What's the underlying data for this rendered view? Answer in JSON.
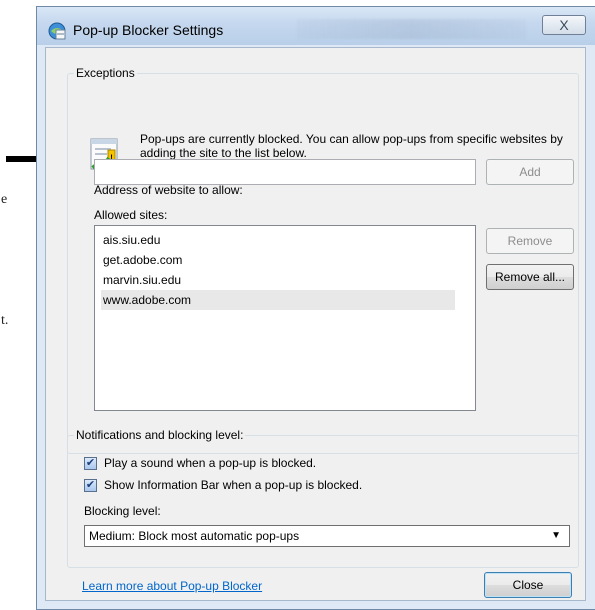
{
  "background": {
    "fragments": [
      "e",
      "t."
    ]
  },
  "window": {
    "title": "Pop-up Blocker Settings",
    "close_glyph": "X"
  },
  "exceptions": {
    "group_label": "Exceptions",
    "info_text": "Pop-ups are currently blocked.  You can allow pop-ups from specific websites by adding the site to the list below.",
    "address_label": "Address of website to allow:",
    "address_value": "",
    "add_label": "Add",
    "allowed_label": "Allowed sites:",
    "allowed_sites": [
      "ais.siu.edu",
      "get.adobe.com",
      "marvin.siu.edu",
      "www.adobe.com"
    ],
    "remove_label": "Remove",
    "remove_all_label": "Remove all..."
  },
  "notifications": {
    "group_label": "Notifications and blocking level:",
    "play_sound_label": "Play a sound when a pop-up is blocked.",
    "play_sound_checked": true,
    "info_bar_label": "Show Information Bar when a pop-up is blocked.",
    "info_bar_checked": true,
    "blocking_level_label": "Blocking level:",
    "blocking_level_value": "Medium: Block most automatic pop-ups"
  },
  "footer": {
    "learn_more_link": "Learn more about Pop-up Blocker",
    "close_label": "Close"
  },
  "icons": {
    "title": "shield-globe-icon",
    "info": "window-check-icon",
    "arrow": "arrow-right-icon",
    "dropdown": "chevron-down-icon",
    "checkbox": "checkmark-icon"
  }
}
